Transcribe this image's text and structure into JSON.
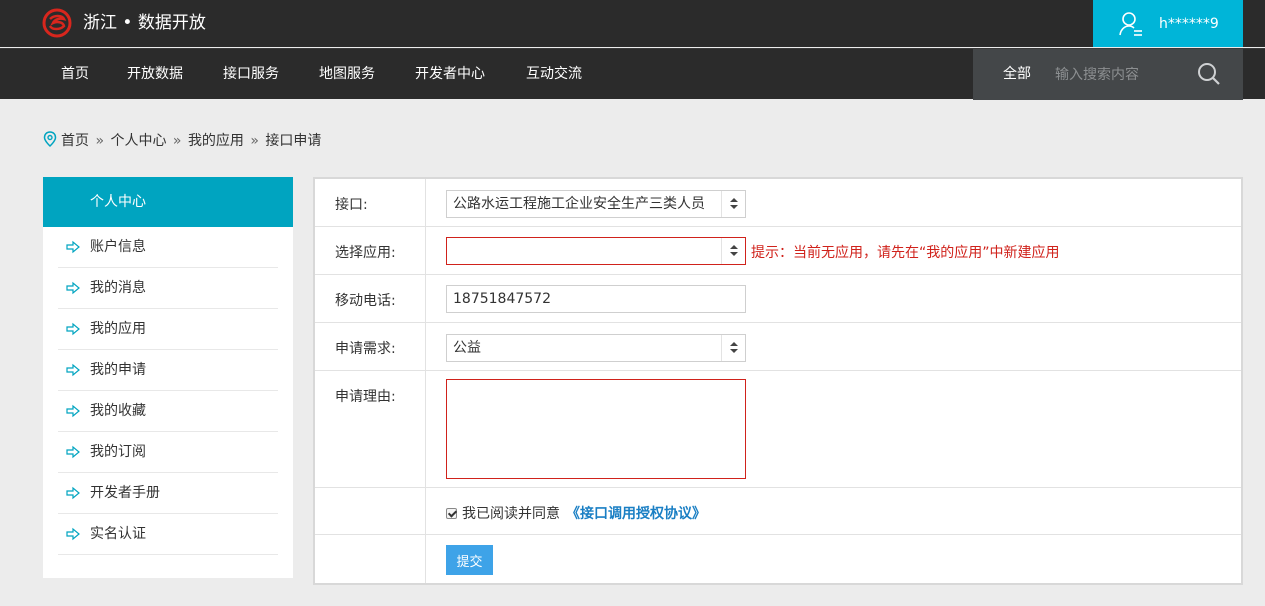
{
  "header": {
    "brand": "浙江 • 数据开放",
    "user_name": "h******9"
  },
  "nav": {
    "items": [
      "首页",
      "开放数据",
      "接口服务",
      "地图服务",
      "开发者中心",
      "互动交流"
    ],
    "search_scope": "全部",
    "search_placeholder": "输入搜索内容"
  },
  "breadcrumb": [
    "首页",
    "个人中心",
    "我的应用",
    "接口申请"
  ],
  "sidebar": {
    "title": "个人中心",
    "items": [
      "账户信息",
      "我的消息",
      "我的应用",
      "我的申请",
      "我的收藏",
      "我的订阅",
      "开发者手册",
      "实名认证"
    ]
  },
  "form": {
    "interface_label": "接口:",
    "interface_value": "公路水运工程施工企业安全生产三类人员",
    "app_label": "选择应用:",
    "app_value": "",
    "app_hint": "提示：当前无应用，请先在“我的应用”中新建应用",
    "phone_label": "移动电话:",
    "phone_value": "18751847572",
    "demand_label": "申请需求:",
    "demand_value": "公益",
    "reason_label": "申请理由:",
    "agree_text": "我已阅读并同意",
    "agree_link": "《接口调用授权协议》",
    "submit_label": "提交"
  },
  "colors": {
    "header_bg": "#2b2b2b",
    "accent": "#00b5d8",
    "sidebar_head": "#00a4c0",
    "error": "#d0221b",
    "link": "#1a7fc4",
    "button": "#3ea3e8"
  }
}
